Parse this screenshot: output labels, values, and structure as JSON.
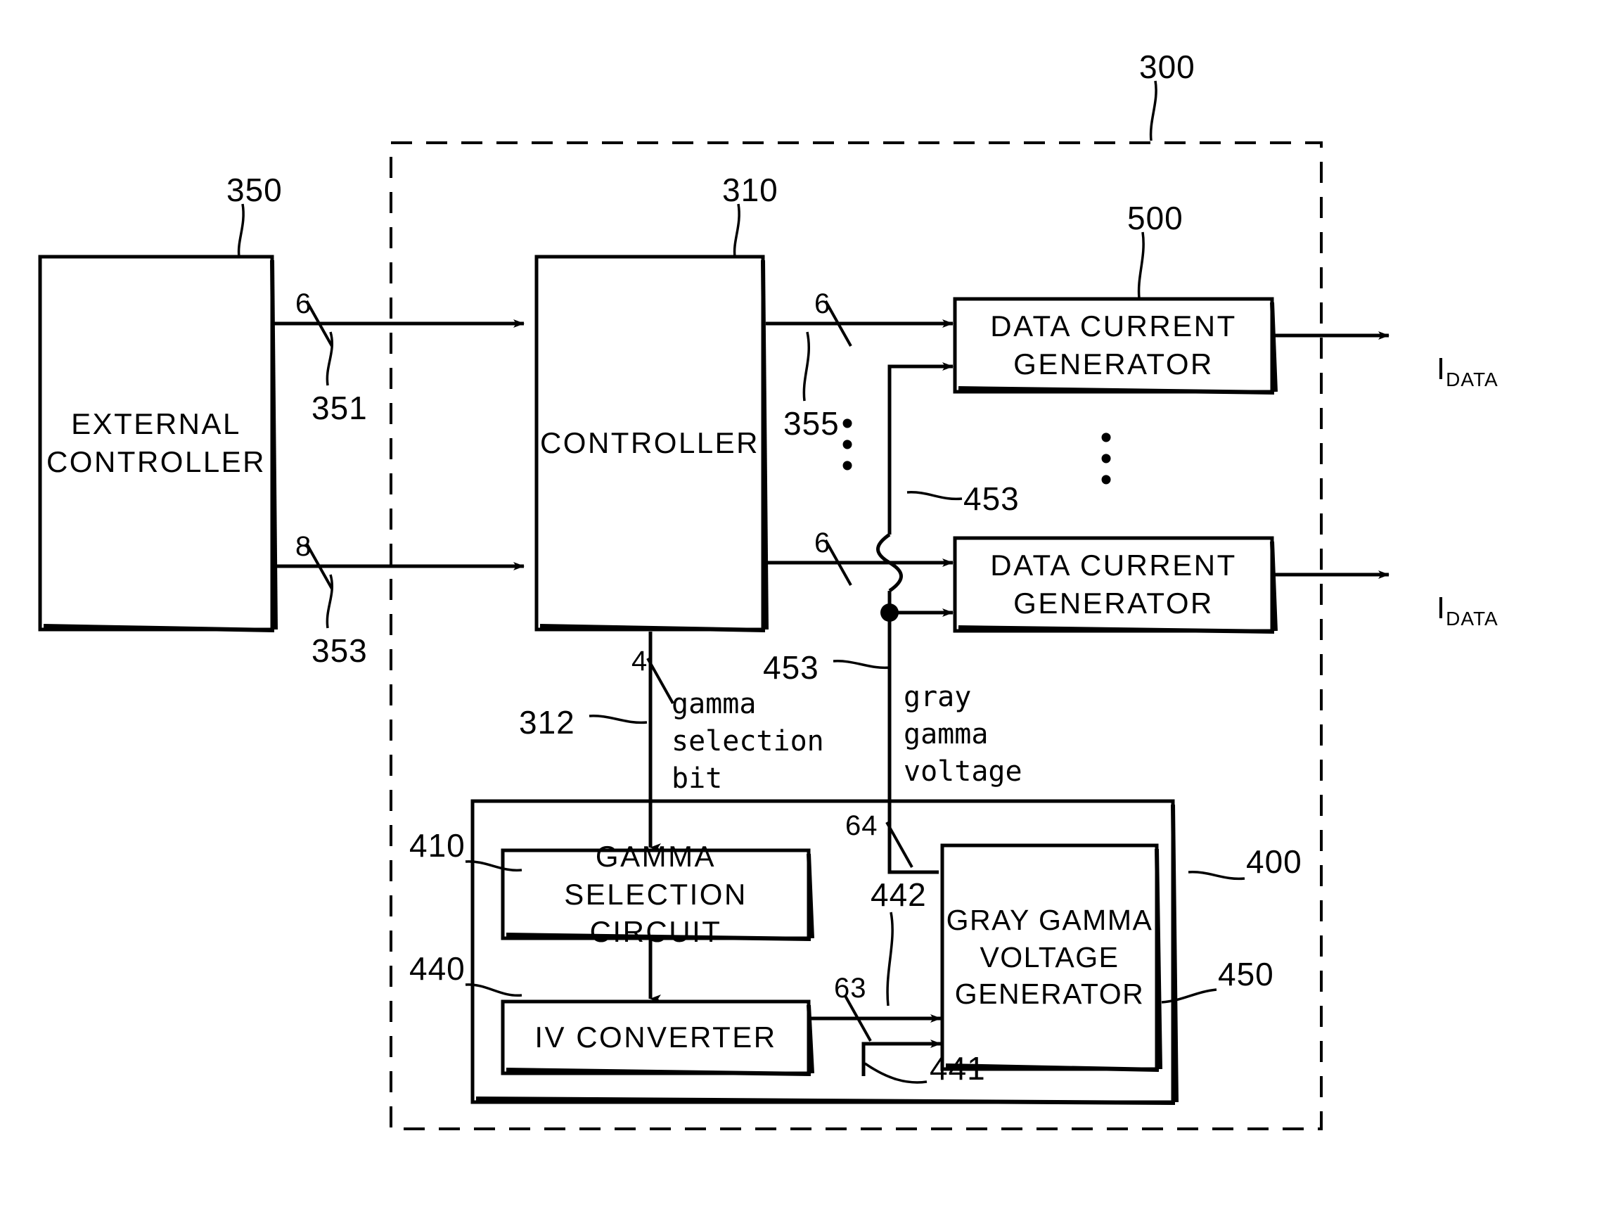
{
  "figure": {
    "type": "patent-block-diagram",
    "domain": "Diagram"
  },
  "blocks": {
    "external_controller": {
      "label": "EXTERNAL\nCONTROLLER",
      "ref": "350"
    },
    "controller": {
      "label": "CONTROLLER",
      "ref": "310"
    },
    "data_current_generator_1": {
      "label": "DATA CURRENT\nGENERATOR",
      "ref": "500"
    },
    "data_current_generator_2": {
      "label": "DATA CURRENT\nGENERATOR",
      "ref": ""
    },
    "gamma_selection_circuit": {
      "label": "GAMMA SELECTION\nCIRCUIT",
      "ref": "410"
    },
    "iv_converter": {
      "label": "IV CONVERTER",
      "ref": "440"
    },
    "gray_gamma_voltage_generator": {
      "label": "GRAY GAMMA\nVOLTAGE\nGENERATOR",
      "ref": "450"
    },
    "inner_dashed_module": {
      "ref": "400"
    },
    "outer_dashed_module": {
      "ref": "300"
    }
  },
  "refs": {
    "r300": "300",
    "r310": "310",
    "r312": "312",
    "r350": "350",
    "r351": "351",
    "r353": "353",
    "r355": "355",
    "r400": "400",
    "r410": "410",
    "r440": "440",
    "r441": "441",
    "r442": "442",
    "r450": "450",
    "r453_top": "453",
    "r453_bottom": "453",
    "r500": "500"
  },
  "bus_widths": {
    "ec_to_ctrl_top": "6",
    "ec_to_ctrl_bottom": "8",
    "ctrl_to_dcg_top": "6",
    "ctrl_to_dcg_bottom": "6",
    "gamma_selection_bit": "4",
    "gray_gamma_voltage": "64",
    "iv_converter_out": "63"
  },
  "signal_labels": {
    "gamma_selection_bit": "gamma\nselection\nbit",
    "gray_gamma_voltage": "gray\ngamma\nvoltage"
  },
  "outputs": {
    "idata_1": {
      "symbol": "I",
      "subscript": "DATA"
    },
    "idata_2": {
      "symbol": "I",
      "subscript": "DATA"
    }
  },
  "ellipses": {
    "left_column": "•\n•\n•",
    "right_column": "•\n•\n•"
  },
  "colors": {
    "ink": "#000000",
    "background": "#ffffff"
  }
}
